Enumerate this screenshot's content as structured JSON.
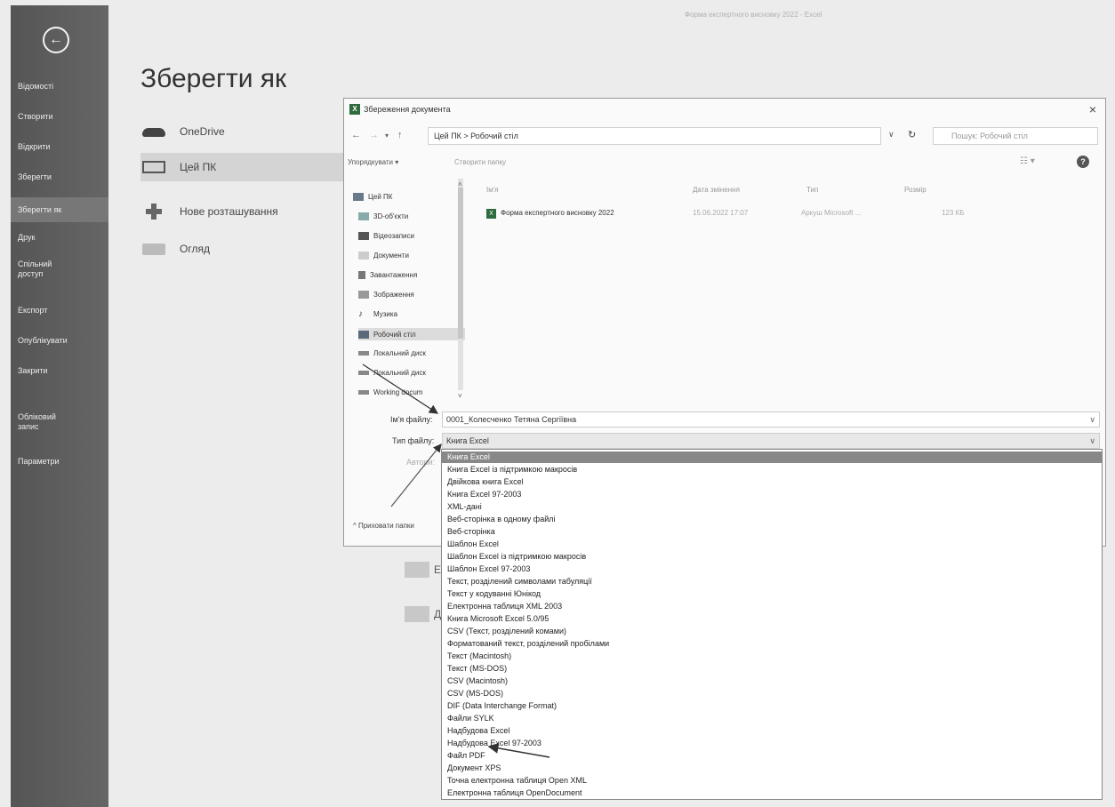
{
  "header_faint": "Форма експертного висновку 2022 - Excel",
  "sidebar": {
    "items": [
      {
        "label": "Відомості"
      },
      {
        "label": "Створити"
      },
      {
        "label": "Відкрити"
      },
      {
        "label": "Зберегти"
      },
      {
        "label": "Зберегти як"
      },
      {
        "label": "Друк"
      },
      {
        "label": "Спільний доступ"
      },
      {
        "label": "Експорт"
      },
      {
        "label": "Опублікувати"
      },
      {
        "label": "Закрити"
      },
      {
        "label": "Обліковий запис"
      },
      {
        "label": "Параметри"
      }
    ],
    "active_index": 4
  },
  "page_title": "Зберегти як",
  "locations": [
    {
      "label": "OneDrive",
      "icon": "cloud-icon"
    },
    {
      "label": "Цей ПК",
      "icon": "computer-icon"
    },
    {
      "label": "Нове розташування",
      "icon": "plus-icon"
    },
    {
      "label": "Огляд",
      "icon": "folder-icon"
    }
  ],
  "background_folders": [
    "E:",
    "Д"
  ],
  "dialog": {
    "title": "Збереження документа",
    "close": "×",
    "address": "Цей ПК  >  Робочий стіл",
    "search_placeholder": "Пошук: Робочий стіл",
    "toolbar": {
      "organize": "Упорядкувати ▾",
      "new_folder": "Створити папку",
      "help": "?"
    },
    "nav_pane": [
      {
        "label": "Цей ПК"
      },
      {
        "label": "3D-об'єкти"
      },
      {
        "label": "Відеозаписи"
      },
      {
        "label": "Документи"
      },
      {
        "label": "Завантаження"
      },
      {
        "label": "Зображення"
      },
      {
        "label": "Музика"
      },
      {
        "label": "Робочий стіл"
      },
      {
        "label": "Локальний диск"
      },
      {
        "label": "Локальний диск"
      },
      {
        "label": "Working docum"
      }
    ],
    "nav_selected_index": 7,
    "columns": {
      "name": "Ім'я",
      "date": "Дата змінення",
      "type": "Тип",
      "size": "Розмір"
    },
    "files": [
      {
        "name": "Форма експертного висновку 2022",
        "date": "15.06.2022 17:07",
        "type": "Аркуш Microsoft ...",
        "size": "123 КБ"
      }
    ],
    "file_name_label": "Ім'я файлу:",
    "file_name_value": "0001_Колесченко Тетяна Сергіївна",
    "file_type_label": "Тип файлу:",
    "file_type_value": "Книга Excel",
    "authors_label": "Автори:",
    "hide_folders": "^ Приховати папки"
  },
  "file_types": [
    "Книга Excel",
    "Книга Excel із підтримкою макросів",
    "Двійкова книга Excel",
    "Книга Excel 97-2003",
    "XML-дані",
    "Веб-сторінка в одному файлі",
    "Веб-сторінка",
    "Шаблон Excel",
    "Шаблон Excel із підтримкою макросів",
    "Шаблон Excel 97-2003",
    "Текст, розділений символами табуляції",
    "Текст у кодуванні Юнікод",
    "Електронна таблиця XML 2003",
    "Книга Microsoft Excel 5.0/95",
    "CSV (Текст, розділений комами)",
    "Форматований текст, розділений пробілами",
    "Текст (Macintosh)",
    "Текст (MS-DOS)",
    "CSV (Macintosh)",
    "CSV (MS-DOS)",
    "DIF (Data Interchange Format)",
    "Файли SYLK",
    "Надбудова Excel",
    "Надбудова Excel 97-2003",
    "Файл PDF",
    "Документ XPS",
    "Точна електронна таблиця Open XML",
    "Електронна таблиця OpenDocument"
  ],
  "file_types_selected_index": 0,
  "colors": {
    "sidebar": "#5a5a5a",
    "excel_green": "#2e6b3e",
    "selection": "#888888"
  }
}
